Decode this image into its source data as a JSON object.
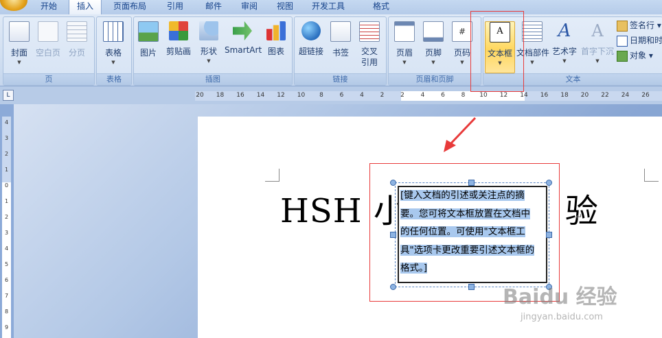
{
  "tabs": [
    "开始",
    "插入",
    "页面布局",
    "引用",
    "邮件",
    "审阅",
    "视图",
    "开发工具",
    "格式"
  ],
  "active_tab": "插入",
  "groups": {
    "pages": {
      "label": "页",
      "buttons": [
        "封面",
        "空白页",
        "分页"
      ]
    },
    "tables": {
      "label": "表格",
      "buttons": [
        "表格"
      ]
    },
    "illustrations": {
      "label": "插图",
      "buttons": [
        "图片",
        "剪贴画",
        "形状",
        "SmartArt",
        "图表"
      ]
    },
    "links": {
      "label": "链接",
      "buttons": [
        "超链接",
        "书签",
        "交叉",
        "引用"
      ]
    },
    "header_footer": {
      "label": "页眉和页脚",
      "buttons": [
        "页眉",
        "页脚",
        "页码"
      ]
    },
    "text": {
      "label": "文本",
      "buttons": [
        "文本框",
        "文档部件",
        "艺术字",
        "首字下沉"
      ],
      "side": [
        "签名行",
        "日期和时",
        "对象"
      ]
    }
  },
  "ruler_numbers": [
    "20",
    "18",
    "16",
    "14",
    "12",
    "10",
    "8",
    "6",
    "4",
    "2",
    "2",
    "4",
    "6",
    "8",
    "10",
    "12",
    "14",
    "16",
    "18",
    "20",
    "22",
    "24",
    "26"
  ],
  "document": {
    "title": "HSH 小",
    "title_tail": "验",
    "textbox_text": "[键入文档的引述或关注点的摘要。您可将文本框放置在文档中的任何位置。可使用\"文本框工具\"选项卡更改重要引述文本框的格式。]",
    "para_mark": "↵"
  },
  "watermark": {
    "main": "Baidu 经验",
    "sub": "jingyan.baidu.com"
  },
  "colors": {
    "annotation": "#e83a3a",
    "selection": "#a8c8ee",
    "highlight_button": "#ffd75e"
  }
}
